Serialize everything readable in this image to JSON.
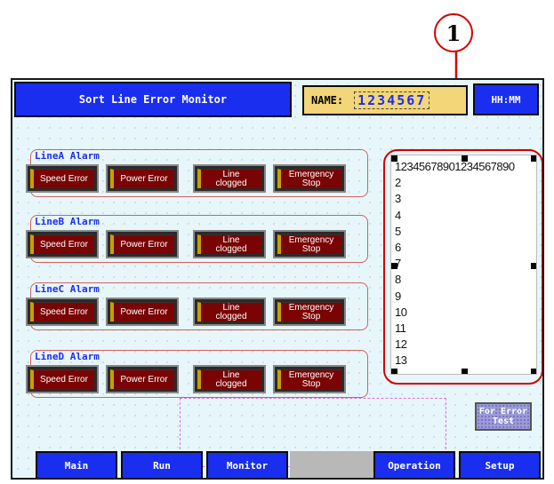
{
  "callout": {
    "number": "1"
  },
  "header": {
    "title": "Sort Line Error Monitor",
    "name_label": "NAME:",
    "name_value": "1234567",
    "time_label": "HH:MM"
  },
  "groups": [
    {
      "title": "LineA Alarm",
      "buttons": [
        "Speed Error",
        "Power Error",
        "Line\nclogged",
        "Emergency\nStop"
      ]
    },
    {
      "title": "LineB Alarm",
      "buttons": [
        "Speed Error",
        "Power Error",
        "Line\nclogged",
        "Emergency\nStop"
      ]
    },
    {
      "title": "LineC Alarm",
      "buttons": [
        "Speed Error",
        "Power Error",
        "Line\nclogged",
        "Emergency\nStop"
      ]
    },
    {
      "title": "LineD Alarm",
      "buttons": [
        "Speed Error",
        "Power Error",
        "Line\nclogged",
        "Emergency\nStop"
      ]
    }
  ],
  "error_list": {
    "lines": [
      "12345678901234567890",
      "2",
      "3",
      "4",
      "5",
      "6",
      "7",
      "8",
      "9",
      "10",
      "11",
      "12",
      "13"
    ]
  },
  "error_test_button": {
    "line1": "For Error",
    "line2": "Test"
  },
  "nav": {
    "main": "Main",
    "run": "Run",
    "monitor": "Monitor",
    "operation": "Operation",
    "setup": "Setup"
  },
  "colors": {
    "accent": "#1a2ef0",
    "alarm": "#7a0404",
    "highlight": "#d40000",
    "name_box": "#f3d677"
  }
}
